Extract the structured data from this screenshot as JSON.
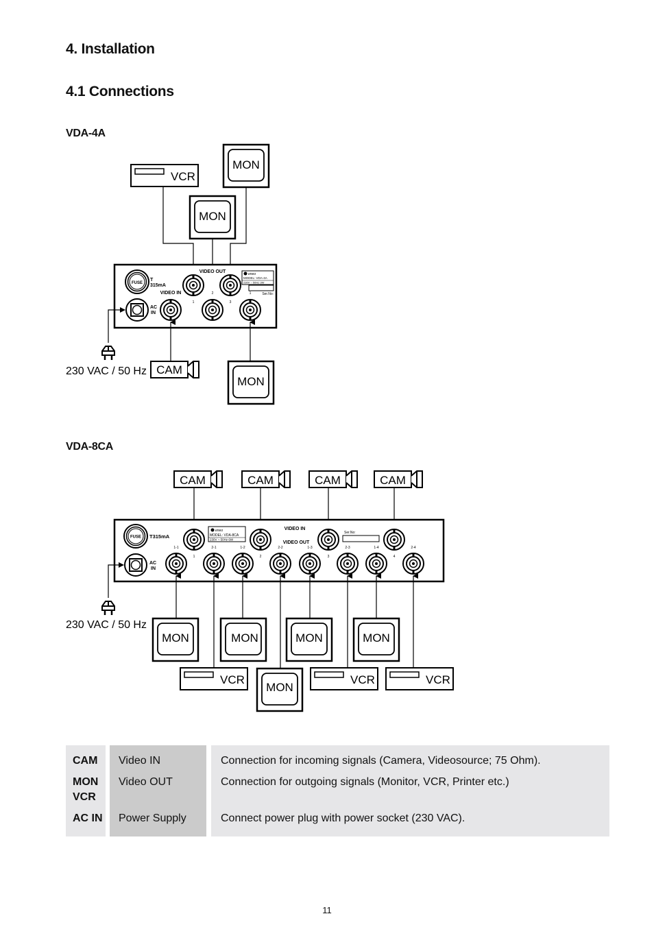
{
  "headings": {
    "chapter": "4.  Installation",
    "section": "4.1  Connections",
    "vda4a": "VDA-4A",
    "vda8ca": "VDA-8CA"
  },
  "devices": {
    "cam": "CAM",
    "mon": "MON",
    "vcr": "VCR"
  },
  "power": {
    "label": "230 VAC / 50 Hz"
  },
  "vda4a_panel": {
    "fuse": "FUSE",
    "fuse_rating_1": "T",
    "fuse_rating_2": "315mA",
    "video_in": "VIDEO IN",
    "video_out": "VIDEO OUT",
    "ac_1": "AC",
    "ac_2": "IN",
    "brand": "eneo",
    "model": "MODEL: VDA-4A",
    "spec": "230V ~ 50Hz  3W",
    "serial": "Ser.No:",
    "out_nums": [
      "1",
      "2",
      "3"
    ],
    "in_num": "1"
  },
  "vda8ca_panel": {
    "fuse": "FUSE",
    "fuse_rating": "T315mA",
    "video_in": "VIDEO IN",
    "video_out": "VIDEO OUT",
    "ac_1": "AC",
    "ac_2": "IN",
    "brand": "eneo",
    "model": "MODEL: VDA-8CA",
    "spec": "230V ~ 50Hz     6W",
    "serial": "Ser.No:",
    "in_nums": [
      "1",
      "2",
      "3",
      "4"
    ],
    "out_labels": [
      "1-1",
      "2-1",
      "1-2",
      "2-2",
      "1-3",
      "2-3",
      "1-4",
      "2-4"
    ]
  },
  "legend_table": {
    "rows": [
      {
        "key": "CAM",
        "type": "Video IN",
        "desc": "Connection for incoming signals (Camera, Videosource; 75 Ohm)."
      },
      {
        "key": "MON",
        "key2": "VCR",
        "type": "Video OUT",
        "desc": "Connection for outgoing signals (Monitor, VCR, Printer etc.)"
      },
      {
        "key": "AC IN",
        "type": "Power Supply",
        "desc": "Connect power plug with power socket (230 VAC)."
      }
    ]
  },
  "page_number": "11"
}
